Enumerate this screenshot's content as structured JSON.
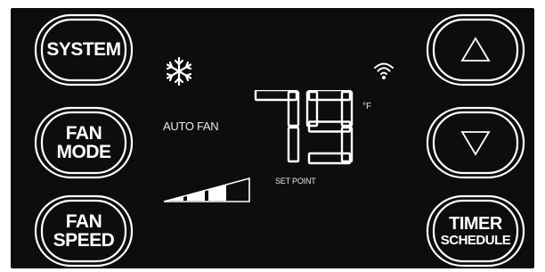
{
  "buttons": {
    "system": [
      "SYSTEM"
    ],
    "fan_mode": [
      "FAN",
      "MODE"
    ],
    "fan_speed": [
      "FAN",
      "SPEED"
    ],
    "up": "up",
    "down": "down",
    "timer_schedule": [
      "TIMER",
      "SCHEDULE"
    ]
  },
  "display": {
    "mode_icon": "snowflake-icon",
    "wifi_icon": "wifi-icon",
    "fan_label": "AUTO FAN",
    "temperature": "79",
    "unit": "°F",
    "setpoint_label": "SET POINT",
    "fan_speed_level": 0.75
  },
  "colors": {
    "background": "#0d0d0d",
    "foreground": "#ffffff"
  }
}
